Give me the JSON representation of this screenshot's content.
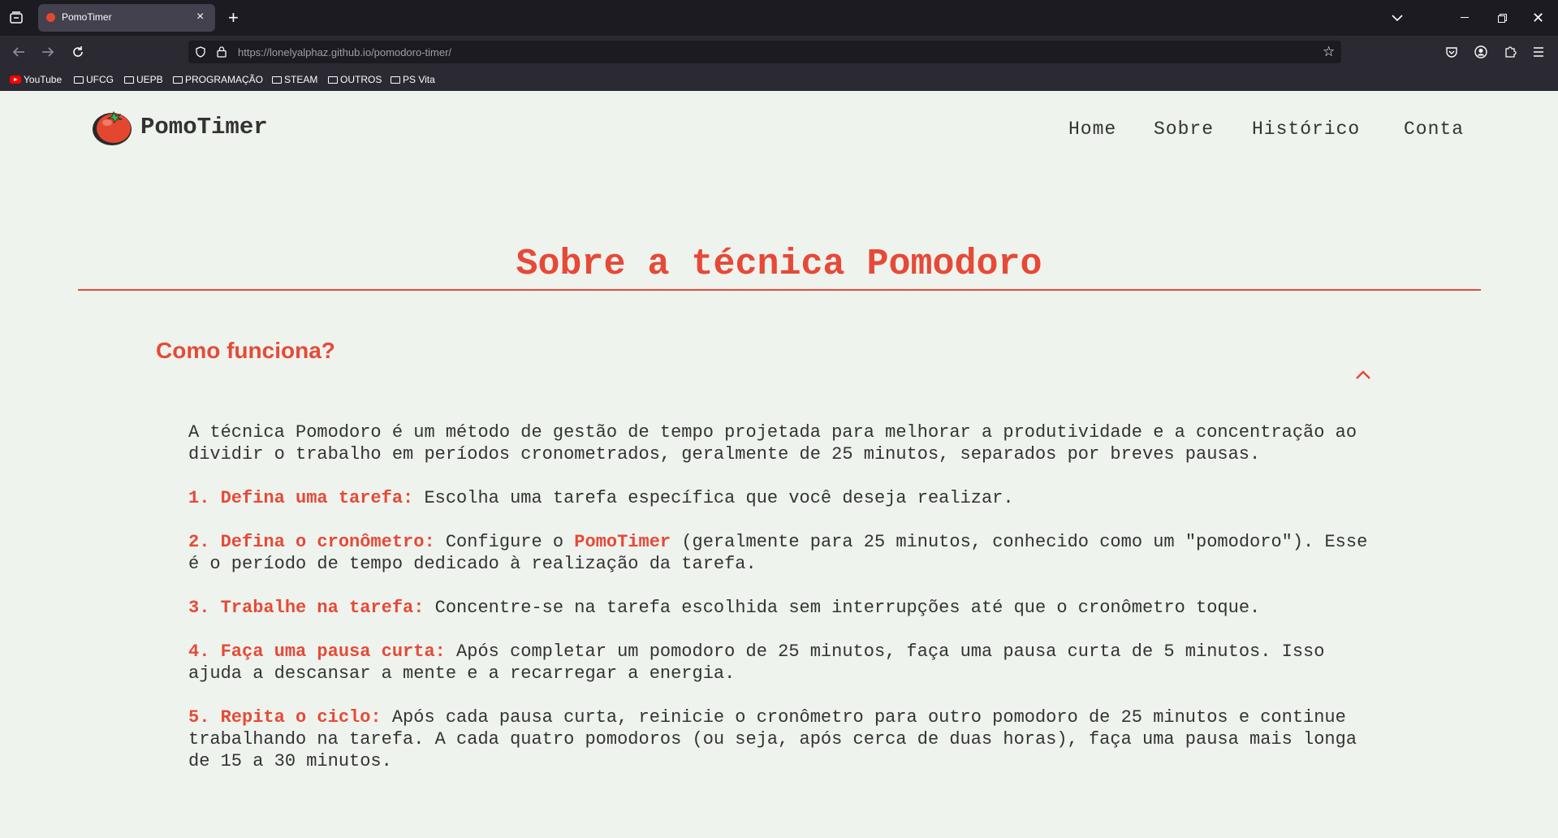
{
  "browser": {
    "tab_title": "PomoTimer",
    "url_host": "https://lonelyalphaz.github.io",
    "url_path": "/pomodoro-timer/",
    "bookmarks": [
      "YouTube",
      "UFCG",
      "UEPB",
      "PROGRAMAÇÃO",
      "STEAM",
      "OUTROS",
      "PS Vita"
    ]
  },
  "site": {
    "brand": "PomoTimer",
    "nav": [
      "Home",
      "Sobre",
      "Histórico",
      "Conta"
    ]
  },
  "main": {
    "title": "Sobre a técnica Pomodoro",
    "section_title": "Como funciona?",
    "intro": "A técnica Pomodoro é um método de gestão de tempo projetada para melhorar a produtividade e a concentração ao dividir o trabalho em períodos cronometrados, geralmente de 25 minutos, separados por breves pausas.",
    "steps": [
      {
        "label": "1. Defina uma tarefa:",
        "text": " Escolha uma tarefa específica que você deseja realizar."
      },
      {
        "label": "2. Defina o cronômetro:",
        "text_before": " Configure o ",
        "highlight": "PomoTimer",
        "text": " (geralmente para 25 minutos, conhecido como um \"pomodoro\"). Esse é o período de tempo dedicado à realização da tarefa."
      },
      {
        "label": "3. Trabalhe na tarefa:",
        "text": " Concentre-se na tarefa escolhida sem interrupções até que o cronômetro toque."
      },
      {
        "label": "4. Faça uma pausa curta:",
        "text": " Após completar um pomodoro de 25 minutos, faça uma pausa curta de 5 minutos. Isso ajuda a descansar a mente e a recarregar a energia."
      },
      {
        "label": "5. Repita o ciclo:",
        "text": " Após cada pausa curta, reinicie o cronômetro para outro pomodoro de 25 minutos e continue trabalhando na tarefa. A cada quatro pomodoros (ou seja, após cerca de duas horas), faça uma pausa mais longa de 15 a 30 minutos."
      }
    ]
  },
  "colors": {
    "accent": "#e64a37",
    "background": "#eff3ee",
    "text": "#333333"
  }
}
